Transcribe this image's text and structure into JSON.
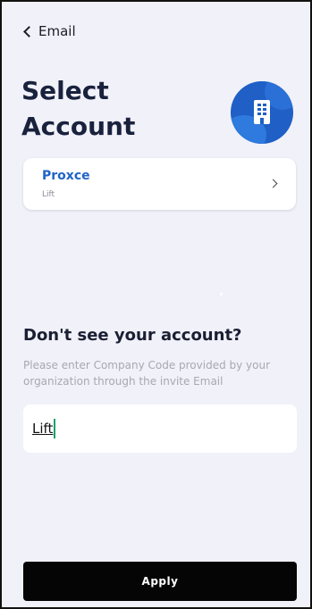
{
  "header": {
    "back_label": "Email",
    "title": "Select Account"
  },
  "avatar": {
    "icon": "building-icon",
    "color": "#1f5fc6"
  },
  "accounts": [
    {
      "name": "Proxce",
      "subtitle": "Lift"
    }
  ],
  "company_code": {
    "heading": "Don't see your account?",
    "hint": "Please enter Company Code provided by your organization through the invite Email",
    "value": "Lift"
  },
  "actions": {
    "apply_label": "Apply"
  },
  "colors": {
    "background": "#f1f1f9",
    "accent": "#2064c8",
    "button": "#050505"
  }
}
